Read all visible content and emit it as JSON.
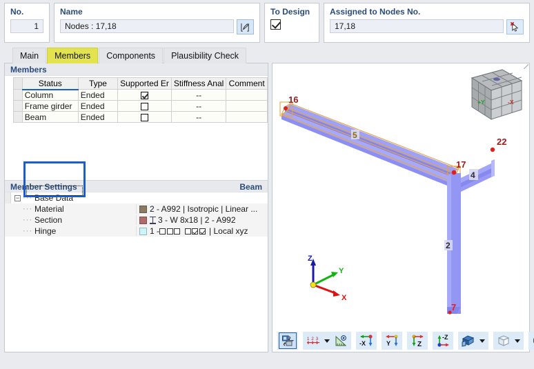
{
  "header": {
    "no_label": "No.",
    "no_value": "1",
    "name_label": "Name",
    "name_value": "Nodes : 17,18",
    "name_edit_icon": "edit-pencil-icon",
    "to_design_label": "To Design",
    "to_design_checked": true,
    "assigned_label": "Assigned to Nodes No.",
    "assigned_value": "17,18",
    "assigned_pick_icon": "pick-cursor-delete-icon"
  },
  "tabs": [
    {
      "label": "Main",
      "active": false
    },
    {
      "label": "Members",
      "active": true
    },
    {
      "label": "Components",
      "active": false
    },
    {
      "label": "Plausibility Check",
      "active": false
    }
  ],
  "members_section": {
    "title": "Members",
    "columns": [
      "Status",
      "Type",
      "Supported Er",
      "Stiffness Anal",
      "Comment"
    ],
    "active_column": "Status",
    "rows": [
      {
        "status": "Column",
        "type": "Ended",
        "supported_end": true,
        "stiffness": "--",
        "comment": ""
      },
      {
        "status": "Frame girder",
        "type": "Ended",
        "supported_end": false,
        "stiffness": "--",
        "comment": ""
      },
      {
        "status": "Beam",
        "type": "Ended",
        "supported_end": false,
        "stiffness": "--",
        "comment": ""
      }
    ],
    "selected_rows": [
      "Column",
      "Frame girder",
      "Beam"
    ],
    "focused_cell": "Beam"
  },
  "member_settings": {
    "title": "Member Settings",
    "context_label": "Beam",
    "root": "Base Data",
    "rows": [
      {
        "label": "Material",
        "value": "2 - A992 | Isotropic | Linear ...",
        "swatch": "#8a7a63",
        "icon": "color-swatch-icon"
      },
      {
        "label": "Section",
        "value": "3 - W 8x18 | 2 - A992",
        "swatch": "#b06a6a",
        "icon": "i-beam-section-icon"
      },
      {
        "label": "Hinge",
        "value": "1 - □□□ □☑☑ | Local xyz",
        "swatch": "#ccf5f7",
        "icon": "hinge-releases-icon",
        "hinge_prefix": "1 - ",
        "hinge_boxes": [
          false,
          false,
          false,
          null,
          false,
          true,
          true
        ],
        "hinge_suffix": "| Local xyz"
      }
    ]
  },
  "view3d": {
    "nav_cube": {
      "name": "navigation-cube",
      "face_y_label": "+Y",
      "face_x_label": "-X"
    },
    "axis_triad": {
      "z": "Z",
      "y": "Y",
      "x": "X"
    },
    "node_labels": [
      "16",
      "17",
      "22",
      "7"
    ],
    "member_labels": [
      "5",
      "4",
      "2"
    ],
    "selected_member": "5",
    "colors": {
      "member_fill": "#8a8cf0",
      "member_light": "#a9abf7",
      "selection_outline": "#e8a33d",
      "node_dot": "#e02020",
      "node_label": "#9b1b1b",
      "axis_z": "#1a1aa8",
      "axis_y": "#11b511",
      "axis_x": "#e01010"
    }
  },
  "view_toolbar": {
    "groups": [
      {
        "buttons": [
          {
            "name": "render-toggle-icon",
            "selected": true
          }
        ]
      },
      {
        "buttons": [
          {
            "name": "numbering-123-icon",
            "selected": false
          },
          {
            "name": "dropdown-caret",
            "caret": true
          },
          {
            "name": "view-angle-ruler-icon",
            "selected": false
          }
        ]
      },
      {
        "buttons": [
          {
            "name": "view-minus-x-icon",
            "label": "-X",
            "selected": false
          }
        ]
      },
      {
        "buttons": [
          {
            "name": "view-y-icon",
            "label": "Y",
            "selected": false
          }
        ]
      },
      {
        "buttons": [
          {
            "name": "view-z-icon",
            "label": "Z",
            "selected": false
          }
        ]
      },
      {
        "buttons": [
          {
            "name": "view-minus-z-icon",
            "label": "-Z",
            "selected": false
          }
        ]
      },
      {
        "buttons": [
          {
            "name": "solid-model-icon",
            "selected": false
          },
          {
            "name": "dropdown-caret",
            "caret": true
          }
        ]
      },
      {
        "buttons": [
          {
            "name": "wireframe-box-icon",
            "selected": false
          },
          {
            "name": "dropdown-caret",
            "caret": true
          }
        ]
      },
      {
        "buttons": [
          {
            "name": "print-icon",
            "selected": false
          },
          {
            "name": "dropdown-caret",
            "caret": true
          }
        ]
      },
      {
        "buttons": [
          {
            "name": "deselect-all-icon",
            "selected": false
          }
        ]
      }
    ]
  }
}
